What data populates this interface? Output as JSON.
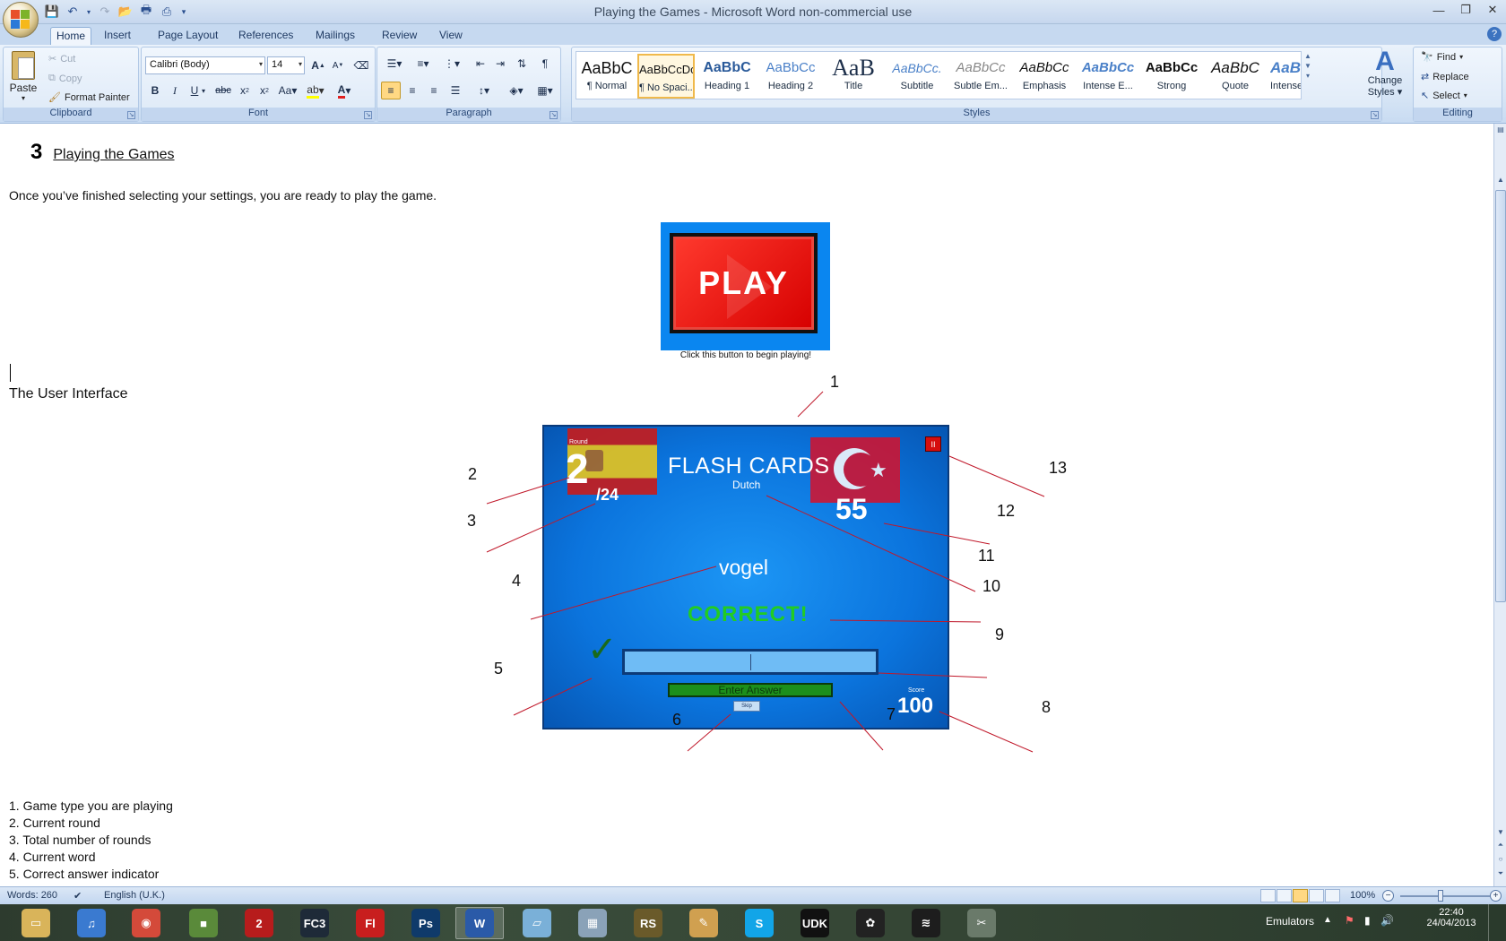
{
  "window": {
    "title": "Playing the Games - Microsoft Word non-commercial use",
    "controls": [
      "minimize-icon",
      "restore-icon",
      "close-icon"
    ]
  },
  "ribbon": {
    "tabs": [
      {
        "label": "Home",
        "active": true
      },
      {
        "label": "Insert"
      },
      {
        "label": "Page Layout"
      },
      {
        "label": "References"
      },
      {
        "label": "Mailings"
      },
      {
        "label": "Review"
      },
      {
        "label": "View"
      }
    ],
    "clipboard": {
      "paste": "Paste",
      "cut": "Cut",
      "copy": "Copy",
      "format_painter": "Format Painter",
      "label": "Clipboard"
    },
    "font": {
      "family": "Calibri (Body)",
      "size": "14",
      "label": "Font"
    },
    "paragraph": {
      "label": "Paragraph"
    },
    "styles": {
      "label": "Styles",
      "items": [
        {
          "sample": "AaBbC",
          "name": "¶ Normal"
        },
        {
          "sample": "AaBbCcDc",
          "name": "¶ No Spaci...",
          "selected": true
        },
        {
          "sample": "AaBbC",
          "name": "Heading 1"
        },
        {
          "sample": "AaBbCc",
          "name": "Heading 2"
        },
        {
          "sample": "AaB",
          "name": "Title"
        },
        {
          "sample": "AaBbCc.",
          "name": "Subtitle"
        },
        {
          "sample": "AaBbCc",
          "name": "Subtle Em..."
        },
        {
          "sample": "AaBbCc",
          "name": "Emphasis"
        },
        {
          "sample": "AaBbCc",
          "name": "Intense E..."
        },
        {
          "sample": "AaBbCc",
          "name": "Strong"
        },
        {
          "sample": "AaBbC",
          "name": "Quote"
        },
        {
          "sample": "AaBb",
          "name": "Intense Q..."
        }
      ],
      "change_styles_line1": "Change",
      "change_styles_line2": "Styles"
    },
    "editing": {
      "label": "Editing",
      "find": "Find",
      "replace": "Replace",
      "select": "Select"
    }
  },
  "document": {
    "heading_num": "3",
    "heading_text": "Playing the Games",
    "intro": "Once you’ve finished selecting your settings, you are ready to play the game.",
    "play_button_text": "PLAY",
    "play_caption": "Click this button to begin playing!",
    "ui_heading": "The User Interface",
    "game_ui": {
      "round_label": "Round",
      "round": "2",
      "total": "/24",
      "title": "FLASH CARDS",
      "language": "Dutch",
      "timer": "55",
      "word": "vogel",
      "feedback": "CORRECT!",
      "check": "✓",
      "enter_answer": "Enter Answer",
      "skip": "Skip",
      "score_label": "Score",
      "score": "100",
      "pause": "II"
    },
    "callouts": [
      "1",
      "2",
      "3",
      "4",
      "5",
      "6",
      "7",
      "8",
      "9",
      "10",
      "11",
      "12",
      "13"
    ],
    "legend": [
      "1. Game type you are playing",
      "2. Current round",
      "3. Total number of rounds",
      "4. Current word",
      "5. Correct answer indicator"
    ]
  },
  "status": {
    "words": "Words: 260",
    "language": "English (U.K.)",
    "zoom": "100%"
  },
  "taskbar": {
    "tray_label": "Emulators",
    "time": "22:40",
    "date": "24/04/2013",
    "apps": [
      {
        "name": "file-explorer-icon",
        "color": "#d9b45a",
        "glyph": "▭"
      },
      {
        "name": "itunes-icon",
        "color": "#3a7ad0",
        "glyph": "♫"
      },
      {
        "name": "chrome-icon",
        "color": "#d44a3a",
        "glyph": "◉"
      },
      {
        "name": "minecraft-icon",
        "color": "#5a8a3a",
        "glyph": "■"
      },
      {
        "name": "guild-wars-2-icon",
        "color": "#b71c1c",
        "glyph": "2"
      },
      {
        "name": "fc3-icon",
        "color": "#1e2a38",
        "glyph": "FC3"
      },
      {
        "name": "flash-icon",
        "color": "#c81e1e",
        "glyph": "Fl"
      },
      {
        "name": "photoshop-icon",
        "color": "#0f3a6a",
        "glyph": "Ps"
      },
      {
        "name": "word-icon",
        "color": "#2a5aa8",
        "glyph": "W"
      },
      {
        "name": "notepad-icon",
        "color": "#7ab0d8",
        "glyph": "▱"
      },
      {
        "name": "calculator-icon",
        "color": "#8aa2b8",
        "glyph": "▦"
      },
      {
        "name": "runescape-icon",
        "color": "#6a5a2a",
        "glyph": "RS"
      },
      {
        "name": "paint-icon",
        "color": "#d0a050",
        "glyph": "✎"
      },
      {
        "name": "skype-icon",
        "color": "#12a5e8",
        "glyph": "S"
      },
      {
        "name": "udk-icon",
        "color": "#111",
        "glyph": "UDK"
      },
      {
        "name": "steam-icon",
        "color": "#222",
        "glyph": "✿"
      },
      {
        "name": "spotify-icon",
        "color": "#1d1d1d",
        "glyph": "≋"
      },
      {
        "name": "tools-icon",
        "color": "#6a7a6a",
        "glyph": "✂"
      }
    ]
  }
}
